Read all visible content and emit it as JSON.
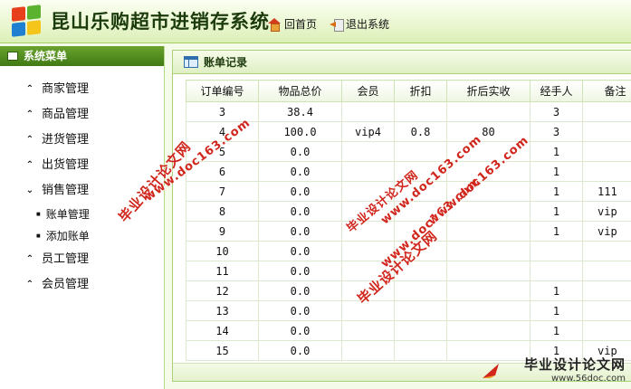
{
  "app": {
    "title": "昆山乐购超市进销存系统"
  },
  "top_nav": {
    "home_label": "回首页",
    "logout_label": "退出系统"
  },
  "sidebar": {
    "header": "系统菜单",
    "items": [
      {
        "label": "商家管理",
        "state": "collapsed"
      },
      {
        "label": "商品管理",
        "state": "collapsed"
      },
      {
        "label": "进货管理",
        "state": "collapsed"
      },
      {
        "label": "出货管理",
        "state": "collapsed"
      },
      {
        "label": "销售管理",
        "state": "expanded"
      },
      {
        "label": "员工管理",
        "state": "collapsed"
      },
      {
        "label": "会员管理",
        "state": "collapsed"
      }
    ],
    "sub_items": [
      {
        "label": "账单管理"
      },
      {
        "label": "添加账单"
      }
    ]
  },
  "panel": {
    "title": "账单记录",
    "columns": [
      "订单编号",
      "物品总价",
      "会员",
      "折扣",
      "折后实收",
      "经手人",
      "备注"
    ],
    "rows": [
      {
        "id": "3",
        "total": "38.4",
        "member": "",
        "discount": "",
        "actual": "",
        "handler": "3",
        "note": ""
      },
      {
        "id": "4",
        "total": "100.0",
        "member": "vip4",
        "discount": "0.8",
        "actual": "80",
        "handler": "3",
        "note": ""
      },
      {
        "id": "5",
        "total": "0.0",
        "member": "",
        "discount": "",
        "actual": "",
        "handler": "1",
        "note": ""
      },
      {
        "id": "6",
        "total": "0.0",
        "member": "",
        "discount": "",
        "actual": "",
        "handler": "1",
        "note": ""
      },
      {
        "id": "7",
        "total": "0.0",
        "member": "",
        "discount": "",
        "actual": "",
        "handler": "1",
        "note": "111"
      },
      {
        "id": "8",
        "total": "0.0",
        "member": "",
        "discount": "",
        "actual": "",
        "handler": "1",
        "note": "vip"
      },
      {
        "id": "9",
        "total": "0.0",
        "member": "",
        "discount": "",
        "actual": "",
        "handler": "1",
        "note": "vip"
      },
      {
        "id": "10",
        "total": "0.0",
        "member": "",
        "discount": "",
        "actual": "",
        "handler": "",
        "note": ""
      },
      {
        "id": "11",
        "total": "0.0",
        "member": "",
        "discount": "",
        "actual": "",
        "handler": "",
        "note": ""
      },
      {
        "id": "12",
        "total": "0.0",
        "member": "",
        "discount": "",
        "actual": "",
        "handler": "1",
        "note": ""
      },
      {
        "id": "13",
        "total": "0.0",
        "member": "",
        "discount": "",
        "actual": "",
        "handler": "1",
        "note": ""
      },
      {
        "id": "14",
        "total": "0.0",
        "member": "",
        "discount": "",
        "actual": "",
        "handler": "1",
        "note": ""
      },
      {
        "id": "15",
        "total": "0.0",
        "member": "",
        "discount": "",
        "actual": "",
        "handler": "1",
        "note": "vip"
      }
    ]
  },
  "watermarks": {
    "cn": "毕业设计论文网",
    "url": "www.doc163.com",
    "brand_title": "毕业设计论文网",
    "brand_url": "www.56doc.com"
  },
  "colors": {
    "accent": "#3f7a14",
    "watermark": "#d0261c"
  }
}
